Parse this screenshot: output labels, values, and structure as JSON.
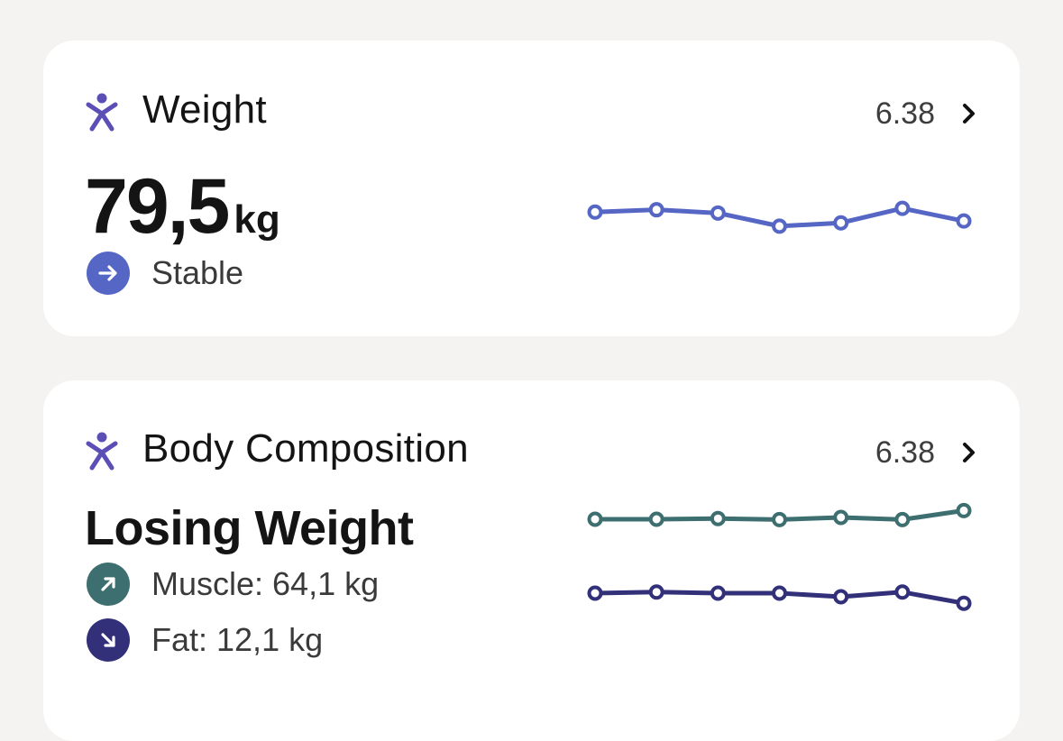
{
  "colors": {
    "background": "#f5f3f1",
    "card": "#ffffff",
    "icon_purple": "#5b4fb6",
    "weight_line": "#5566c4",
    "muscle_line": "#3e6f70",
    "fat_line": "#33307a"
  },
  "weight_card": {
    "icon": "person-arms-up-icon",
    "title": "Weight",
    "date": "6.38",
    "value": "79,5",
    "unit": "kg",
    "trend_icon": "arrow-right-icon",
    "trend_label": "Stable",
    "chart_values": [
      0.61,
      0.66,
      0.59,
      0.31,
      0.38,
      0.69,
      0.42
    ]
  },
  "body_card": {
    "icon": "person-arms-up-icon",
    "title": "Body Composition",
    "date": "6.38",
    "status": "Losing Weight",
    "muscle": {
      "icon": "arrow-up-right-icon",
      "label": "Muscle: 64,1 kg",
      "chart_values": [
        0.45,
        0.45,
        0.47,
        0.44,
        0.5,
        0.44,
        0.69
      ]
    },
    "fat": {
      "icon": "arrow-down-right-icon",
      "label": "Fat: 12,1 kg",
      "chart_values": [
        0.5,
        0.53,
        0.5,
        0.5,
        0.4,
        0.53,
        0.22
      ]
    }
  }
}
